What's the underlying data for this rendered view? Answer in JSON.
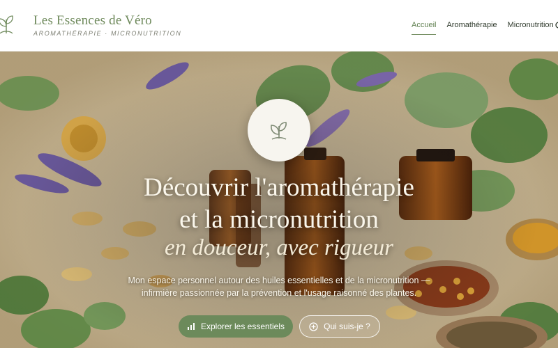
{
  "brand": {
    "name": "Les Essences de Véro",
    "tagline": "AROMATHÉRAPIE · MICRONUTRITION",
    "logo_icon": "plant-sprout-logo"
  },
  "nav": {
    "items": [
      {
        "label": "Accueil",
        "active": true
      },
      {
        "label": "Aromathérapie",
        "active": false
      },
      {
        "label": "Micronutrition",
        "active": false
      }
    ]
  },
  "hero": {
    "emblem_icon": "leaf-sprout-icon",
    "title_line1": "Découvrir l'aromathérapie",
    "title_line2": "et la micronutrition",
    "title_line3": "en douceur, avec rigueur",
    "lead_line1": "Mon espace personnel autour des huiles essentielles et de la micronutrition —",
    "lead_line2": "infirmière passionnée par la prévention et l'usage raisonné des plantes.",
    "primary_button": {
      "label": "Explorer les essentiels",
      "icon": "bar-chart-icon"
    },
    "secondary_button": {
      "label": "Qui suis-je ?",
      "icon": "plus-circle-icon"
    }
  },
  "colors": {
    "accent": "#6f8a5c",
    "button_primary": "#6c8a5b",
    "hero_text": "#fbf7ec"
  }
}
